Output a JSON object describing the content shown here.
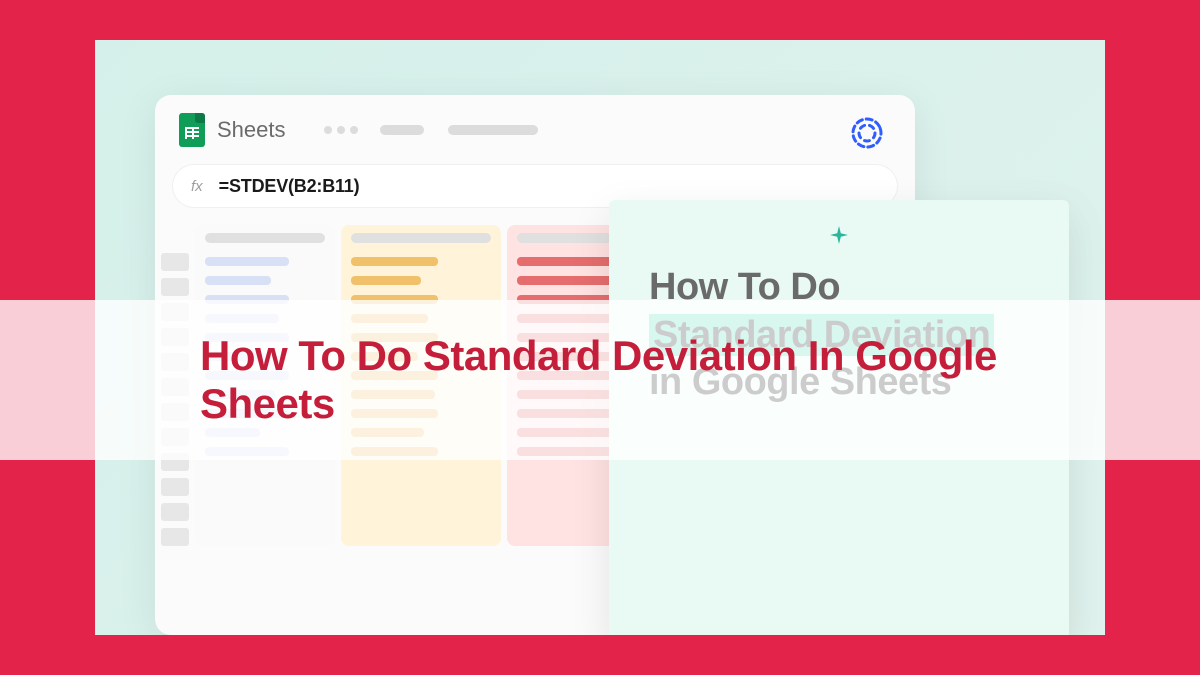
{
  "app": {
    "name": "Sheets",
    "formula": "=STDEV(B2:B11)"
  },
  "card": {
    "line1": "How To Do",
    "line2": "Standard Deviation",
    "line3": "in Google Sheets"
  },
  "overlay": {
    "title": "How To Do Standard Deviation In Google Sheets"
  }
}
